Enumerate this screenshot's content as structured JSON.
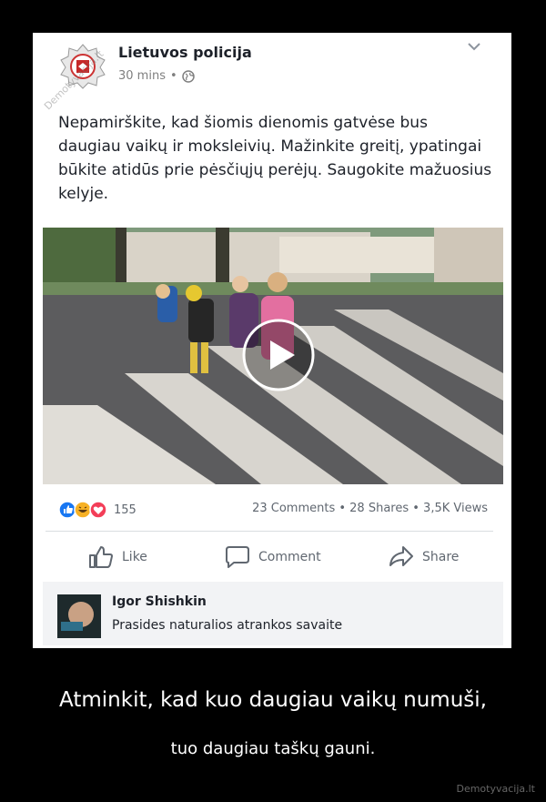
{
  "post": {
    "page_name": "Lietuvos policija",
    "time": "30 mins",
    "privacy_icon": "globe-icon",
    "menu_icon": "chevron-down-icon",
    "watermark": "Demotyvacija.lt",
    "text": "Nepamirškite, kad šiomis dienomis gatvėse bus daugiau vaikų ir moksleivių. Mažinkite greitį, ypatingai būkite atidūs prie pėsčiųjų perėjų. Saugokite mažuosius kelyje."
  },
  "video": {
    "play_icon": "play-icon"
  },
  "stats": {
    "reactions": [
      "like-reaction-icon",
      "haha-reaction-icon",
      "love-reaction-icon"
    ],
    "reaction_count": "155",
    "summary": "23 Comments • 28 Shares • 3,5K Views"
  },
  "actions": {
    "like": "Like",
    "comment": "Comment",
    "share": "Share"
  },
  "comment": {
    "author": "Igor Shishkin",
    "text": "Prasides naturalios atrankos savaite"
  },
  "caption": {
    "main": "Atminkit, kad kuo daugiau vaikų numuši,",
    "sub": "tuo daugiau taškų gauni."
  },
  "site": "Demotyvacija.lt",
  "colors": {
    "accent": "#1877f2",
    "love": "#f33e58",
    "haha": "#f7b125",
    "background": "#000000"
  }
}
